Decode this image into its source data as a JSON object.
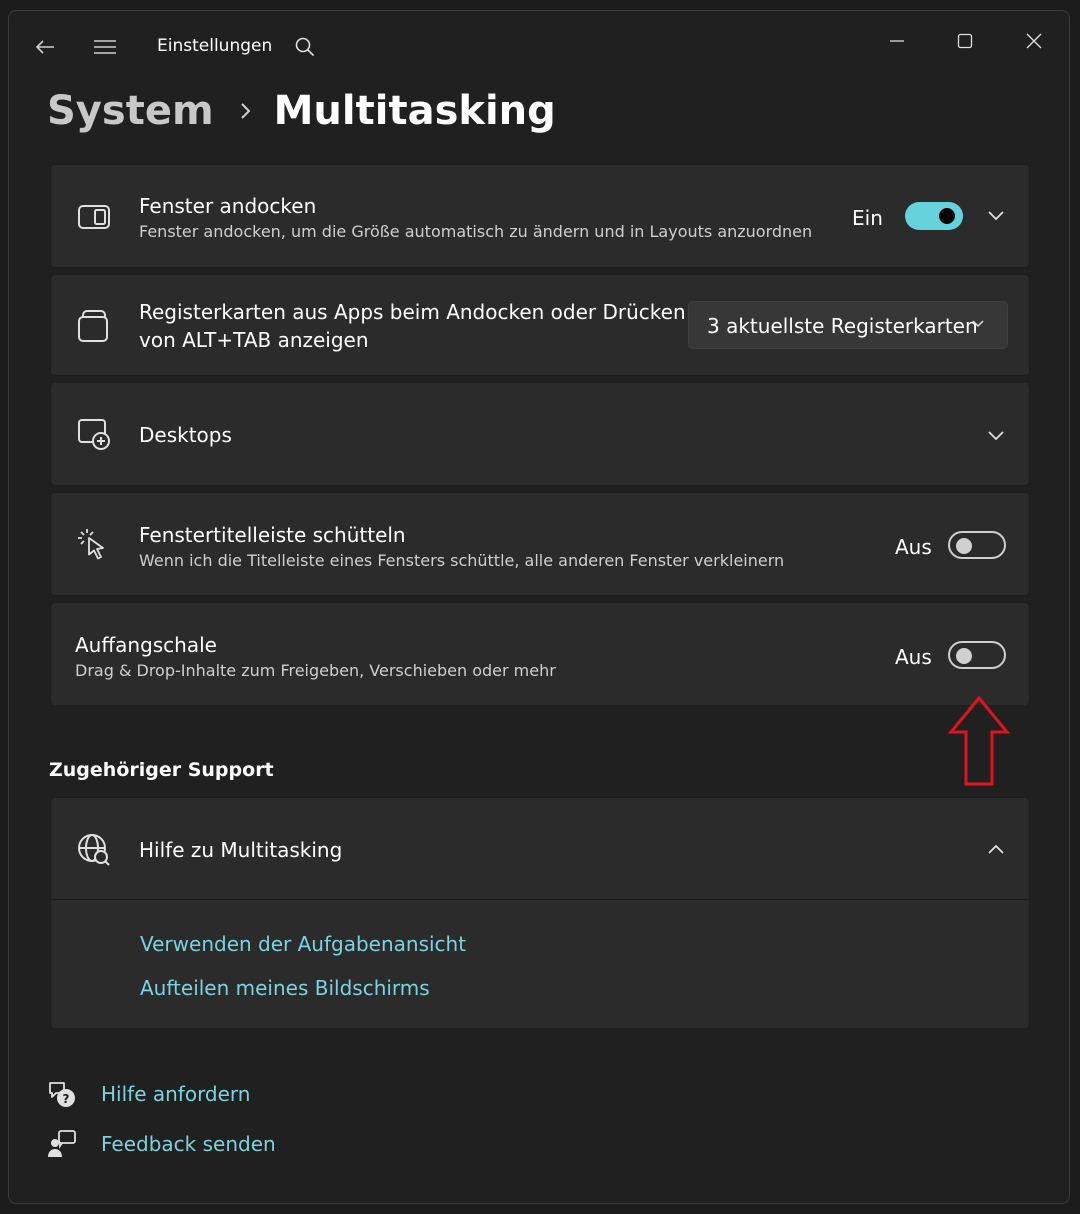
{
  "titlebar": {
    "app_title": "Einstellungen",
    "back_icon": "back-arrow-icon",
    "menu_icon": "hamburger-icon",
    "search_icon": "search-icon",
    "window_controls": [
      "minimize-icon",
      "maximize-icon",
      "close-icon"
    ]
  },
  "breadcrumb": {
    "parent": "System",
    "current": "Multitasking"
  },
  "settings": {
    "snap": {
      "title": "Fenster andocken",
      "subtitle": "Fenster andocken, um die Größe automatisch zu ändern und in Layouts anzuordnen",
      "state": "Ein",
      "enabled": true
    },
    "tabs": {
      "title_line1": "Registerkarten aus Apps beim Andocken oder Drücken",
      "title_line2": "von ALT+TAB anzeigen",
      "selected": "3 aktuellste Registerkarten"
    },
    "desktops": {
      "title": "Desktops"
    },
    "shake": {
      "title": "Fenstertitelleiste schütteln",
      "subtitle": "Wenn ich die Titelleiste eines Fensters schüttle, alle anderen Fenster verkleinern",
      "state": "Aus",
      "enabled": false
    },
    "tray": {
      "title": "Auffangschale",
      "subtitle": "Drag & Drop-Inhalte zum Freigeben, Verschieben oder mehr",
      "state": "Aus",
      "enabled": false
    }
  },
  "support": {
    "heading": "Zugehöriger Support",
    "card_title": "Hilfe zu Multitasking",
    "links": [
      "Verwenden der Aufgabenansicht",
      "Aufteilen meines Bildschirms"
    ]
  },
  "footer": {
    "get_help": "Hilfe anfordern",
    "feedback": "Feedback senden"
  },
  "colors": {
    "accent": "#66d2dc",
    "link": "#7ad4de",
    "annotation_arrow": "#e0141e"
  }
}
